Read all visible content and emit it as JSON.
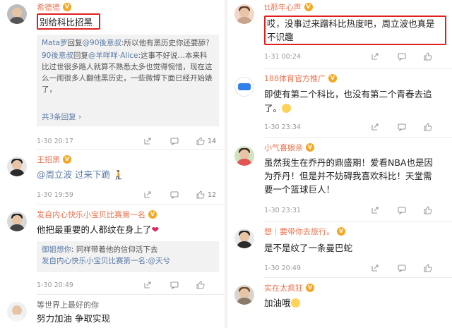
{
  "colors": {
    "username": "#eb7350",
    "link": "#5b7ba6",
    "highlight_box": "#e02020"
  },
  "left": [
    {
      "user": "希德德",
      "text": "别给科比招黑",
      "replies": [
        {
          "author": "Mata罗",
          "mid": "回复",
          "target": "@90後意叔",
          "text": ":所以他有黑历史你还要舔？"
        },
        {
          "author": "90後意叔",
          "mid": "回复",
          "target": "@羊咩咩·Alice",
          "text": ":这事不好说…本来科比过世很多路人就算不熟悉太多也觉得惋惜，现在这么一闹很多人翻他黑历史，一些微博下面已经开始婊了，"
        }
      ],
      "more": "共3条回复",
      "time": "1-30 20:17",
      "likes": "14"
    },
    {
      "user": "王招黑",
      "text": "@周立波  过来下跪",
      "time": "1-30 19:59",
      "likes": "12"
    },
    {
      "user": "发自内心快乐小宝贝比赛第一名",
      "text": "他把最重要的人都纹在身上了",
      "replies": [
        {
          "author": "御姐想你",
          "text": ": 同样带着他的信仰活下去"
        },
        {
          "author": "发自内心快乐小宝贝比赛第一名",
          "text": ":@天兮"
        }
      ],
      "time": "1-30 20:49"
    },
    {
      "user": "等世界上最好的你",
      "text": "努力加油  争取实现"
    }
  ],
  "right": [
    {
      "user": "tt那年心声",
      "text_l1": "哎，没事过来蹭科比热度吧，周立波也真是",
      "text_l2": "不识趣",
      "time": "1-31 00:24"
    },
    {
      "user": "188体育官方推广",
      "text_l1": "即使有第二个科比，也没有第二个青春去追",
      "text_l2": "了。",
      "time": "1-30 23:34"
    },
    {
      "user": "小气喜娘亲",
      "text_l1": "虽然我生在乔丹的鼎盛期！爱看NBA也是因",
      "text_l2": "为乔丹！但是并不妨碍我喜欢科比！天堂需",
      "text_l3": "要一个篮球巨人！",
      "time": "1-30 23:31"
    },
    {
      "user": "想｜要带你去旅行。",
      "text": "是不是纹了一条曼巴蛇",
      "time": "1-30 20:49"
    },
    {
      "user": "实在太疯狂",
      "text": "加油哦"
    }
  ]
}
